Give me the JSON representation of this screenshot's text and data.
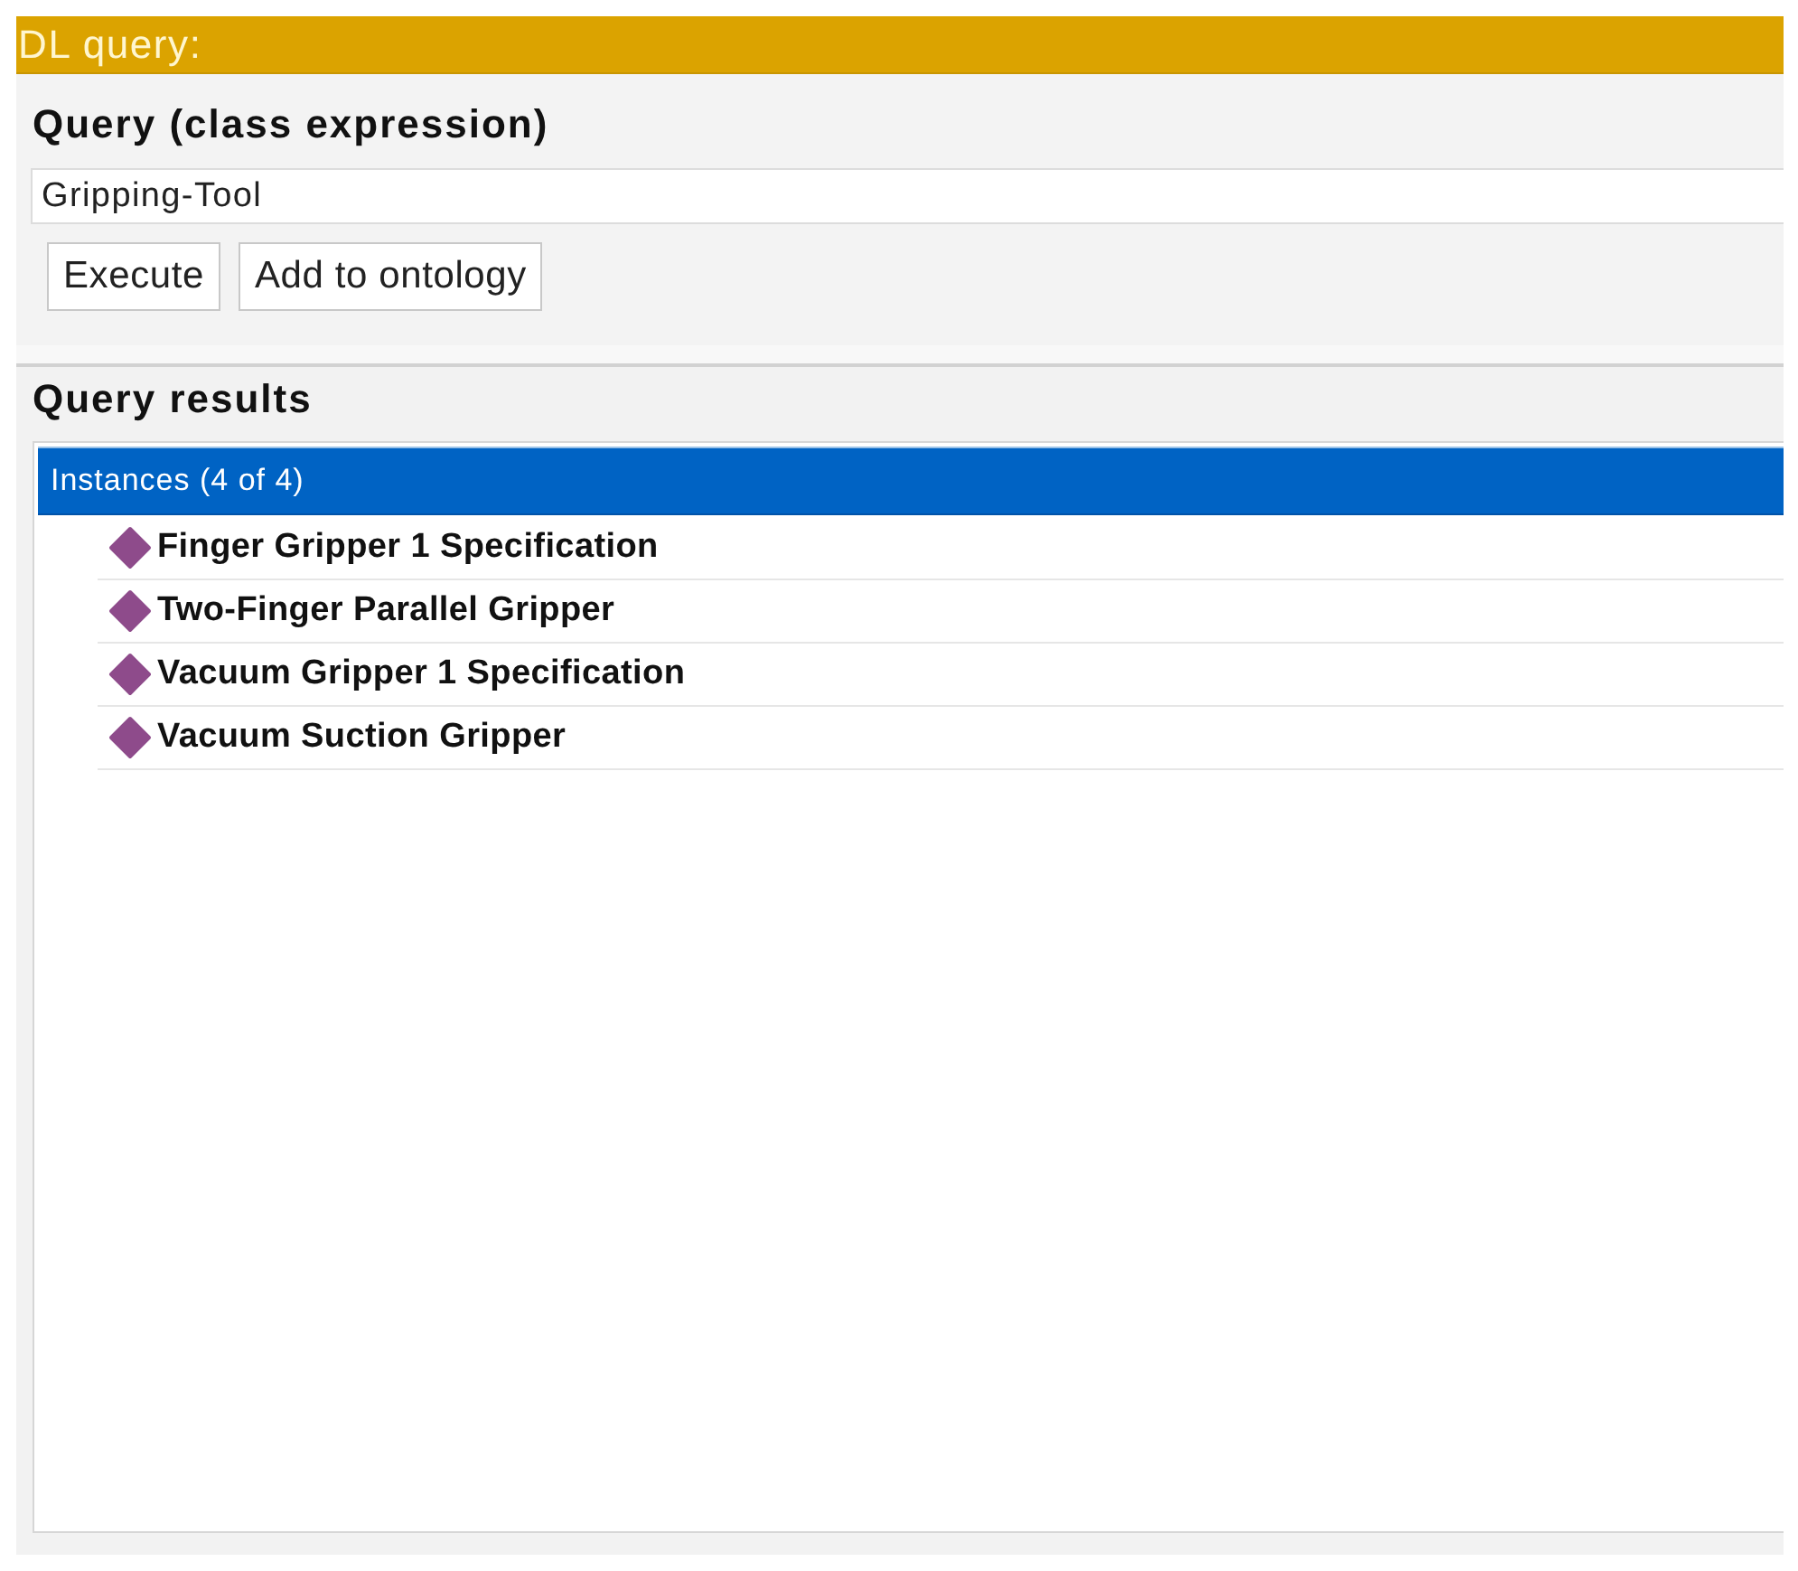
{
  "window": {
    "title": "DL query:"
  },
  "query": {
    "heading": "Query (class expression)",
    "value": "Gripping-Tool",
    "buttons": [
      "Execute",
      "Add to ontology"
    ]
  },
  "results": {
    "heading": "Query results",
    "group": {
      "label": "Instances (4 of 4)",
      "selected": true,
      "items": [
        {
          "label": "Finger Gripper 1 Specification",
          "selected": false
        },
        {
          "label": "Two-Finger Parallel Gripper",
          "selected": false
        },
        {
          "label": "Vacuum Gripper 1 Specification",
          "selected": false
        },
        {
          "label": "Vacuum Suction Gripper",
          "selected": false
        }
      ]
    }
  }
}
